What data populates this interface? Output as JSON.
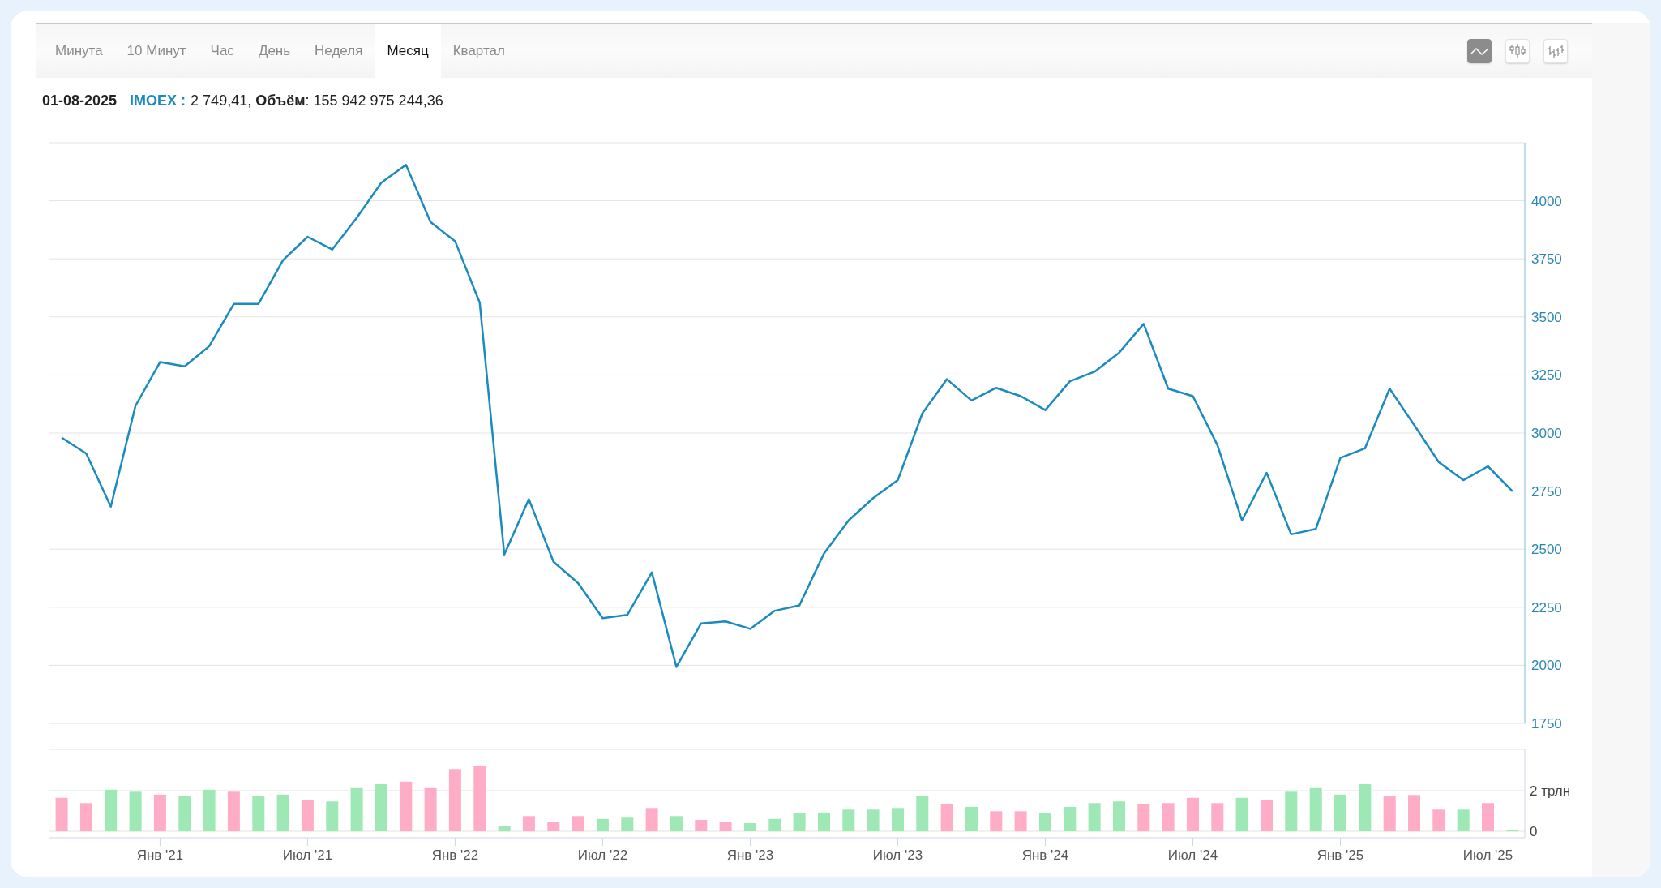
{
  "tabs": [
    {
      "label": "Минута",
      "selected": false
    },
    {
      "label": "10 Минут",
      "selected": false
    },
    {
      "label": "Час",
      "selected": false
    },
    {
      "label": "День",
      "selected": false
    },
    {
      "label": "Неделя",
      "selected": false
    },
    {
      "label": "Месяц",
      "selected": true
    },
    {
      "label": "Квартал",
      "selected": false
    }
  ],
  "chart_types": [
    {
      "kind": "line",
      "selected": true
    },
    {
      "kind": "candles",
      "selected": false
    },
    {
      "kind": "bars",
      "selected": false
    }
  ],
  "info": {
    "date": "01-08-2025",
    "ticker": "IMOEX :",
    "values": "2 749,41, **Объём**: 155 942 975 244,36"
  },
  "price_chart": {
    "chart_data": {
      "type": "line",
      "grid": true,
      "ylim": [
        1750,
        4250
      ],
      "categories": [
        null,
        null,
        null,
        null,
        null,
        null,
        null,
        null,
        null,
        null,
        null,
        null,
        null,
        null,
        null,
        null,
        null,
        null,
        null,
        null,
        null,
        null,
        null,
        null,
        null,
        null,
        null,
        null,
        null,
        null,
        null,
        null,
        null,
        null,
        null,
        null,
        null,
        null,
        null,
        null,
        null,
        null,
        null,
        null,
        null,
        null,
        null,
        null,
        null,
        null,
        null,
        null,
        null,
        null,
        null,
        null,
        null,
        null,
        null,
        null
      ],
      "yticks": [
        1750,
        2000,
        2250,
        2500,
        2750,
        3000,
        3250,
        3500,
        3750,
        4000
      ],
      "series": [
        {
          "color": "#1b8bbf",
          "values": [
            2980,
            2912,
            2683,
            3117,
            3305,
            3287,
            3374,
            3556,
            3556,
            3744,
            3845,
            3790,
            3927,
            4078,
            4155,
            3909,
            3826,
            3561,
            2477,
            2715,
            2446,
            2354,
            2203,
            2217,
            2400,
            1993,
            2180,
            2189,
            2157,
            2235,
            2258,
            2482,
            2624,
            2720,
            2797,
            3085,
            3232,
            3140,
            3195,
            3159,
            3099,
            3223,
            3264,
            3346,
            3470,
            3191,
            3159,
            2948,
            2624,
            2829,
            2564,
            2587,
            2893,
            2934,
            3191,
            3035,
            2875,
            2797,
            2857,
            2749
          ]
        }
      ]
    }
  },
  "volume_chart": {
    "chart_data": {
      "type": "bar",
      "stacked": true,
      "grid": true,
      "ylim": [
        0,
        4.04
      ],
      "categories": [
        null,
        null,
        null,
        null,
        "Янв '21",
        null,
        null,
        null,
        null,
        null,
        "Июл '21",
        null,
        null,
        null,
        null,
        null,
        "Янв '22",
        null,
        null,
        null,
        null,
        null,
        "Июл '22",
        null,
        null,
        null,
        null,
        null,
        "Янв '23",
        null,
        null,
        null,
        null,
        null,
        "Июл '23",
        null,
        null,
        null,
        null,
        null,
        "Янв '24",
        null,
        null,
        null,
        null,
        null,
        "Июл '24",
        null,
        null,
        null,
        null,
        null,
        "Янв '25",
        null,
        null,
        null,
        null,
        null,
        "Июл '25",
        null
      ],
      "yticks": [
        {
          "value": 0,
          "label": "0"
        },
        {
          "value": 2,
          "label": "2 трлн"
        }
      ],
      "series": [
        {
          "color": "#9de8b4",
          "values": [
            null,
            null,
            2.05,
            1.95,
            null,
            1.73,
            2.05,
            null,
            1.73,
            1.81,
            null,
            1.47,
            2.13,
            2.32,
            null,
            null,
            null,
            null,
            0.27,
            null,
            null,
            null,
            0.61,
            0.67,
            null,
            0.75,
            null,
            null,
            0.4,
            0.61,
            0.88,
            0.93,
            1.07,
            1.07,
            1.15,
            1.73,
            null,
            1.2,
            null,
            null,
            0.91,
            1.2,
            1.39,
            1.47,
            null,
            null,
            null,
            null,
            1.65,
            null,
            1.95,
            2.13,
            1.81,
            2.32,
            null,
            null,
            null,
            1.07,
            null,
            0.05
          ]
        },
        {
          "color": "#ffadc6",
          "values": [
            1.65,
            1.39,
            null,
            null,
            1.81,
            null,
            null,
            1.95,
            null,
            null,
            1.52,
            null,
            null,
            null,
            2.45,
            2.13,
            3.07,
            3.2,
            null,
            0.75,
            0.48,
            0.75,
            null,
            null,
            1.15,
            null,
            0.56,
            0.48,
            null,
            null,
            null,
            null,
            null,
            null,
            null,
            null,
            1.33,
            null,
            0.99,
            0.99,
            null,
            null,
            null,
            null,
            1.33,
            1.39,
            1.65,
            1.39,
            null,
            1.52,
            null,
            null,
            null,
            null,
            1.73,
            1.79,
            1.07,
            null,
            1.39,
            null
          ]
        }
      ]
    }
  }
}
